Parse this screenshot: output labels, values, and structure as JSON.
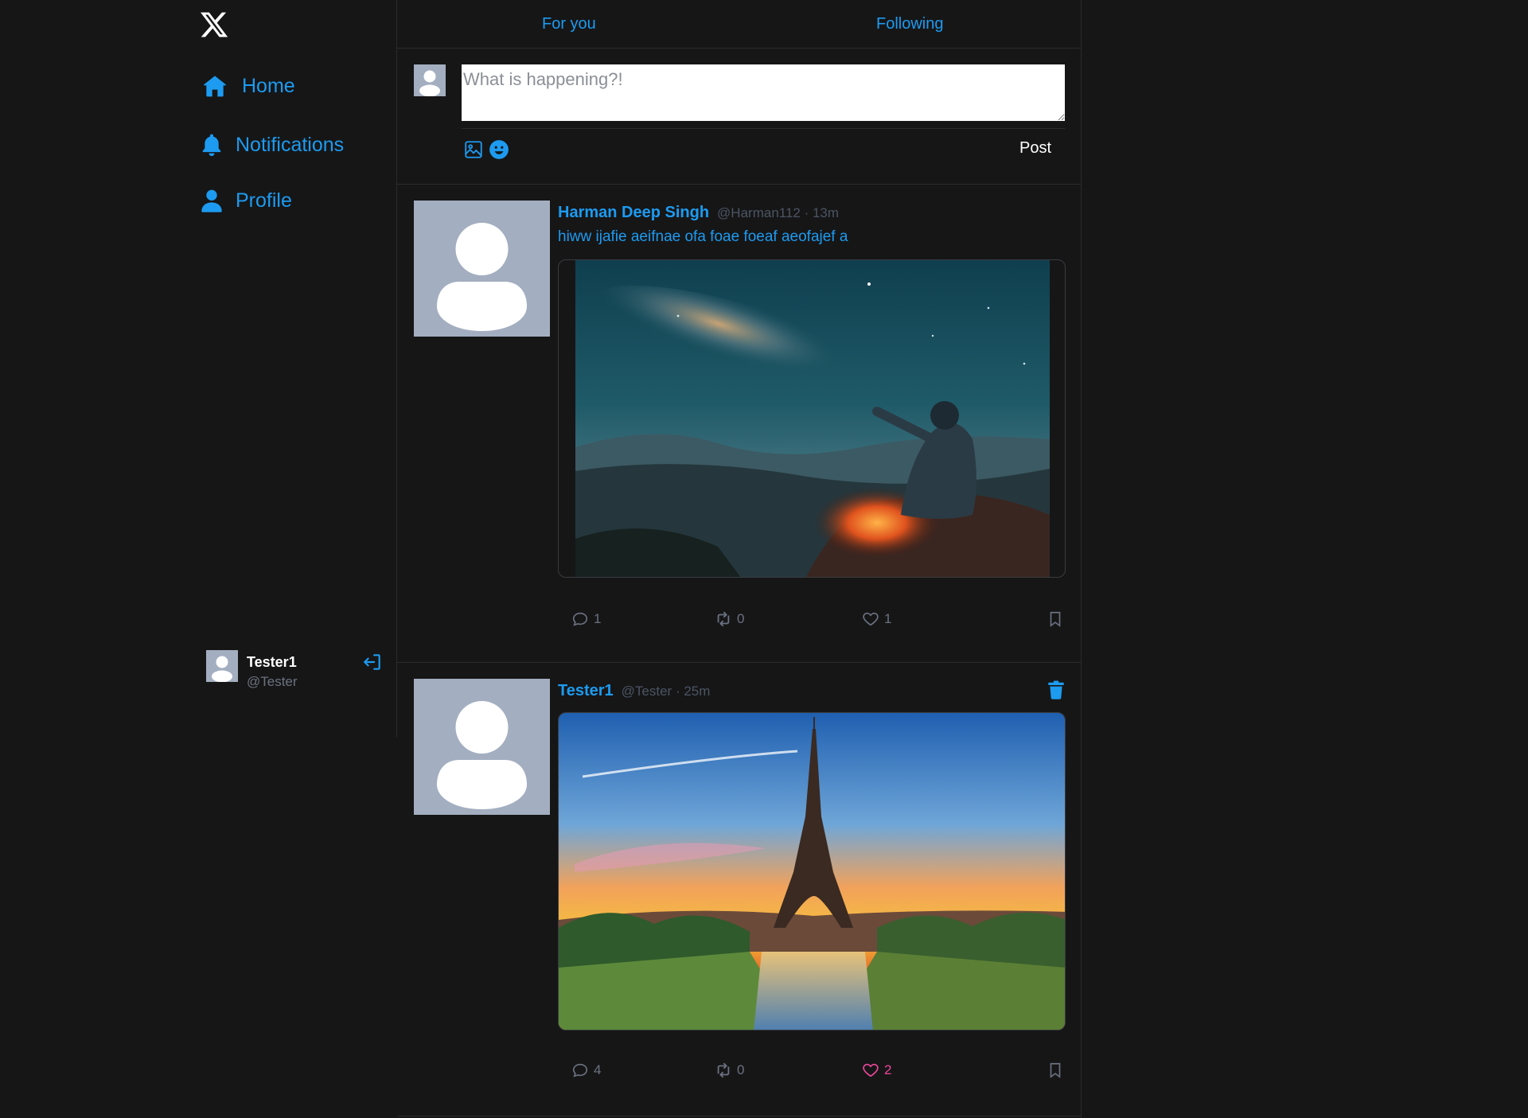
{
  "sidebar": {
    "logo": "x-logo-icon",
    "nav": [
      {
        "label": "Home",
        "icon": "home-icon"
      },
      {
        "label": "Notifications",
        "icon": "bell-icon"
      },
      {
        "label": "Profile",
        "icon": "user-icon"
      }
    ],
    "account": {
      "name": "Tester1",
      "handle": "@Tester",
      "logout_icon": "logout-icon"
    }
  },
  "tabs": [
    {
      "label": "For you"
    },
    {
      "label": "Following"
    }
  ],
  "composer": {
    "placeholder": "What is happening?!",
    "value": "",
    "post_label": "Post",
    "icons": [
      "image-icon",
      "emoji-icon"
    ]
  },
  "posts": [
    {
      "author": "Harman Deep Singh",
      "handle": "@Harman112",
      "time": "13m",
      "meta": "@Harman112 · 13m",
      "text": "hiww ijafie aeifnae ofa foae foeaf aeofajef a",
      "image": "photo-night-sky-campfire",
      "replies": "1",
      "reposts": "0",
      "likes": "1",
      "liked": false,
      "deletable": false
    },
    {
      "author": "Tester1",
      "handle": "@Tester",
      "time": "25m",
      "meta": "@Tester · 25m",
      "text": "",
      "image": "photo-eiffel-tower-sunset",
      "replies": "4",
      "reposts": "0",
      "likes": "2",
      "liked": true,
      "deletable": true
    }
  ],
  "colors": {
    "background": "#161617",
    "accent": "#1d9bf0",
    "like": "#ec4899",
    "muted": "#6b7280",
    "border": "#2a2b2e",
    "avatar_bg": "#a3aec0"
  }
}
